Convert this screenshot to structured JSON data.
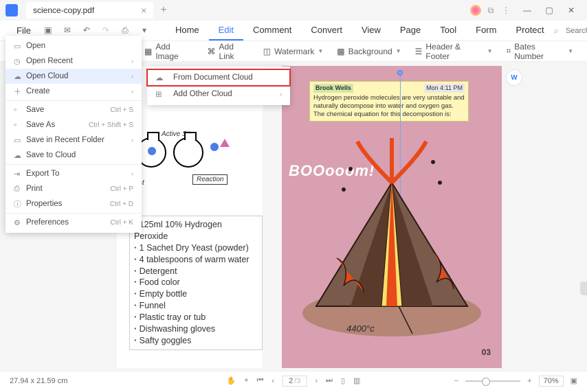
{
  "titlebar": {
    "tab_name": "science-copy.pdf"
  },
  "menubar": {
    "file": "File",
    "tabs": [
      "Home",
      "Edit",
      "Comment",
      "Convert",
      "View",
      "Page",
      "Tool",
      "Form",
      "Protect"
    ],
    "active_tab": 1,
    "search_placeholder": "Search Tools"
  },
  "toolbar": {
    "add_image": "Add Image",
    "add_link": "Add Link",
    "watermark": "Watermark",
    "background": "Background",
    "header_footer": "Header & Footer",
    "bates_number": "Bates Number"
  },
  "file_menu": {
    "open": "Open",
    "open_recent": "Open Recent",
    "open_cloud": "Open Cloud",
    "create": "Create",
    "save": "Save",
    "save_as": "Save As",
    "save_recent_folder": "Save in Recent Folder",
    "save_to_cloud": "Save to Cloud",
    "export_to": "Export To",
    "print": "Print",
    "properties": "Properties",
    "preferences": "Preferences",
    "sc_save": "Ctrl + S",
    "sc_save_as": "Ctrl + Shift + S",
    "sc_print": "Ctrl + P",
    "sc_properties": "Ctrl + D",
    "sc_preferences": "Ctrl + K"
  },
  "submenu": {
    "from_cloud": "From Document Cloud",
    "add_other": "Add Other Cloud"
  },
  "doc": {
    "active_site": "Active Site",
    "reaction": "Reaction",
    "catalyst": "st",
    "materials": [
      "125ml 10% Hydrogen Peroxide",
      "1 Sachet Dry Yeast (powder)",
      "4 tablespoons of warm water",
      "Detergent",
      "Food color",
      "Empty bottle",
      "Funnel",
      "Plastic tray or tub",
      "Dishwashing gloves",
      "Safty goggles"
    ],
    "comment_author": "Brook Wells",
    "comment_time": "Mon 4:11 PM",
    "comment_text": "Hydrogen peroxide molecules are very unstable and naturally decompose into water and oxygen gas. The chemical equation for this decompostion is:",
    "boom": "BOOooom!",
    "temp": "4400°c",
    "page_num": "03"
  },
  "status": {
    "dimensions": "27.94 x 21.59 cm",
    "page_current": "2",
    "page_total": "/3",
    "zoom": "70%"
  }
}
